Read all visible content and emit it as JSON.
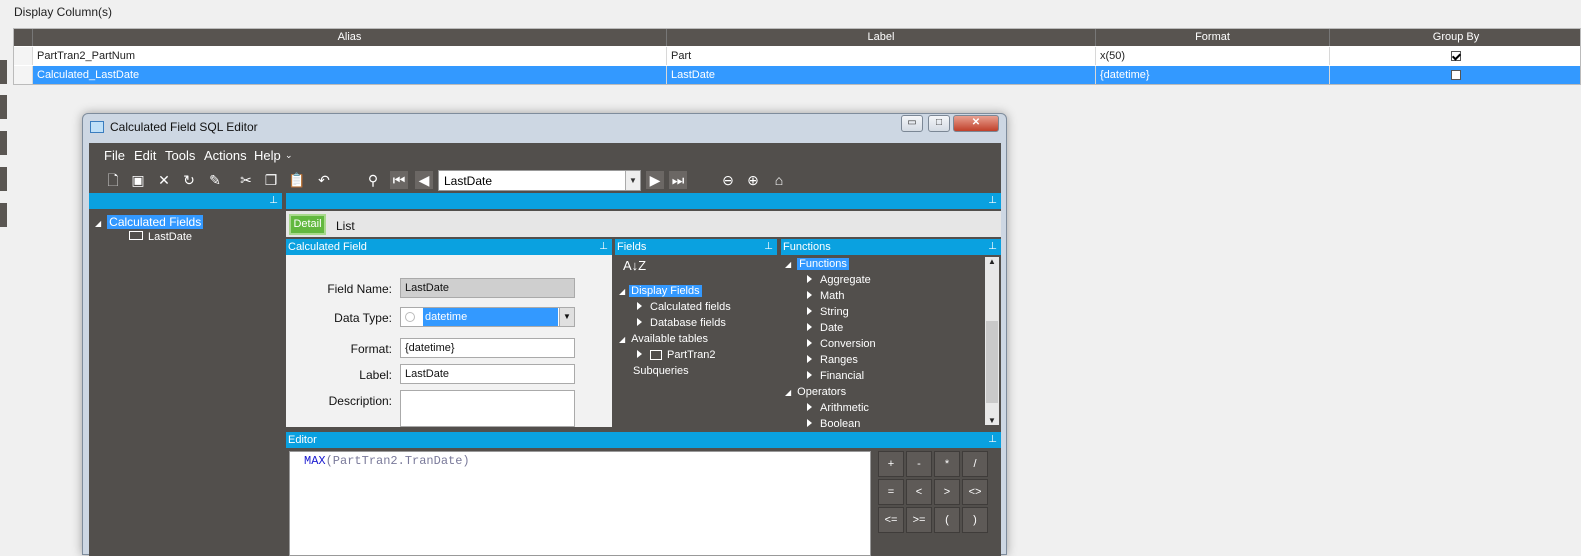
{
  "section_title": "Display Column(s)",
  "grid": {
    "headers": [
      "Alias",
      "Label",
      "Format",
      "Group By"
    ],
    "rows": [
      {
        "alias": "PartTran2_PartNum",
        "label": "Part",
        "format": "x(50)",
        "group_by": true,
        "selected": false
      },
      {
        "alias": "Calculated_LastDate",
        "label": "LastDate",
        "format": "{datetime}",
        "group_by": false,
        "selected": true
      }
    ]
  },
  "window": {
    "title": "Calculated Field SQL Editor",
    "menu": [
      "File",
      "Edit",
      "Tools",
      "Actions",
      "Help"
    ],
    "record_selector": "LastDate",
    "tree": {
      "root": "Calculated Fields",
      "child": "LastDate"
    },
    "tabs": {
      "detail": "Detail",
      "list": "List"
    },
    "calc_panel": {
      "title": "Calculated Field",
      "field_name_label": "Field Name:",
      "field_name": "LastDate",
      "data_type_label": "Data Type:",
      "data_type": "datetime",
      "format_label": "Format:",
      "format": "{datetime}",
      "label_label": "Label:",
      "label": "LastDate",
      "description_label": "Description:"
    },
    "fields_panel": {
      "title": "Fields",
      "root": "Display Fields",
      "items": [
        "Calculated fields",
        "Database fields"
      ],
      "available": "Available tables",
      "table": "PartTran2",
      "subqueries": "Subqueries"
    },
    "functions_panel": {
      "title": "Functions",
      "root": "Functions",
      "items": [
        "Aggregate",
        "Math",
        "String",
        "Date",
        "Conversion",
        "Ranges",
        "Financial"
      ],
      "operators": "Operators",
      "op_items": [
        "Arithmetic",
        "Boolean"
      ]
    },
    "editor": {
      "title": "Editor",
      "fn": "MAX",
      "args": "(PartTran2.TranDate)"
    },
    "ops": [
      "+",
      "-",
      "*",
      "/",
      "=",
      "<",
      ">",
      "<>",
      "<=",
      ">=",
      "(",
      ")"
    ]
  },
  "colors": {
    "header": "#585450",
    "selection": "#3399ff",
    "panel_bar": "#0aa1e0",
    "dark": "#524f4c"
  }
}
